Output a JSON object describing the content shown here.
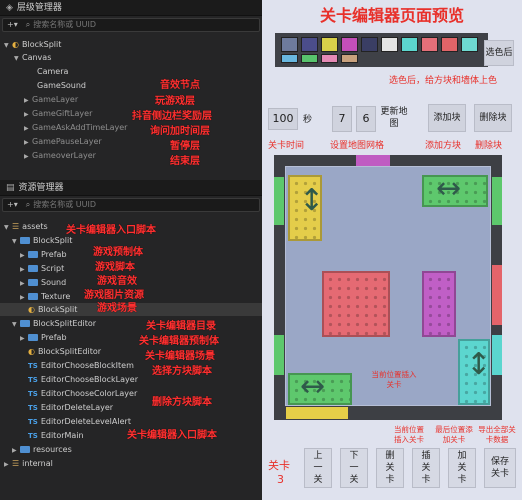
{
  "hierarchy": {
    "title": "层级管理器",
    "search_placeholder": "搜索名称或 UUID",
    "nodes": [
      {
        "label": "BlockSplit"
      },
      {
        "label": "Canvas"
      },
      {
        "label": "Camera"
      },
      {
        "label": "GameSound"
      },
      {
        "label": "GameLayer"
      },
      {
        "label": "GameGiftLayer"
      },
      {
        "label": "GameAskAddTimeLayer"
      },
      {
        "label": "GamePauseLayer"
      },
      {
        "label": "GameoverLayer"
      }
    ],
    "annotations": [
      "音效节点",
      "玩游戏层",
      "抖音侧边栏奖励层",
      "询问加时间层",
      "暂停层",
      "结束层"
    ]
  },
  "assets": {
    "title": "资源管理器",
    "search_placeholder": "搜索名称或 UUID",
    "nodes": [
      {
        "label": "assets"
      },
      {
        "label": "BlockSplit"
      },
      {
        "label": "Prefab"
      },
      {
        "label": "Script"
      },
      {
        "label": "Sound"
      },
      {
        "label": "Texture"
      },
      {
        "label": "BlockSplit"
      },
      {
        "label": "BlockSplitEditor"
      },
      {
        "label": "Prefab"
      },
      {
        "label": "BlockSplitEditor"
      },
      {
        "label": "EditorChooseBlockItem"
      },
      {
        "label": "EditorChooseBlockLayer"
      },
      {
        "label": "EditorChooseColorLayer"
      },
      {
        "label": "EditorDeleteLayer"
      },
      {
        "label": "EditorDeleteLevelAlert"
      },
      {
        "label": "EditorMain"
      },
      {
        "label": "resources"
      },
      {
        "label": "internal"
      }
    ],
    "annotations": {
      "assets": "关卡编辑器入口脚本",
      "prefab": "游戏预制体",
      "script": "游戏脚本",
      "sound": "游戏音效",
      "texture": "游戏图片资源",
      "scene": "游戏场景",
      "editor_dir": "关卡编辑器目录",
      "editor_prefab": "关卡编辑器预制体",
      "editor_scene": "关卡编辑器场景",
      "choose_block": "选择方块脚本",
      "delete_block": "删除方块脚本",
      "editor_main": "关卡编辑器入口脚本"
    }
  },
  "preview": {
    "title": "关卡编辑器页面预览",
    "palette_colors": [
      "#6e7b9c",
      "#4b4d8a",
      "#d9d14a",
      "#c34fb9",
      "#3a3e64",
      "#e4e4e4",
      "#5cd6ce",
      "#e46f79",
      "#e06468",
      "#6ed9d1",
      "#69b8e0",
      "#58c46d",
      "#e58ab5",
      "#c9a27e"
    ],
    "choose_color_button": "选色后",
    "choose_color_note": "选色后，给方块和墙体上色",
    "time_value": "100",
    "time_unit": "秒",
    "time_label": "关卡时间",
    "grid_rows": "7",
    "grid_cols": "6",
    "update_map_button": "更新地图",
    "grid_label": "设置地图网格",
    "add_block_button": "添加块",
    "add_block_label": "添加方块",
    "delete_block_button": "删除块",
    "delete_block_label": "删除块",
    "insert_note": "当前位置插入关卡",
    "level_label": "关卡",
    "level_number": "3",
    "buttons": [
      "上一关",
      "下一关",
      "删关卡",
      "插关卡",
      "加关卡",
      "保存关卡"
    ],
    "bottom_notes": [
      "当前位置插入关卡",
      "最后位置添加关卡",
      "导出全部关卡数据"
    ]
  }
}
